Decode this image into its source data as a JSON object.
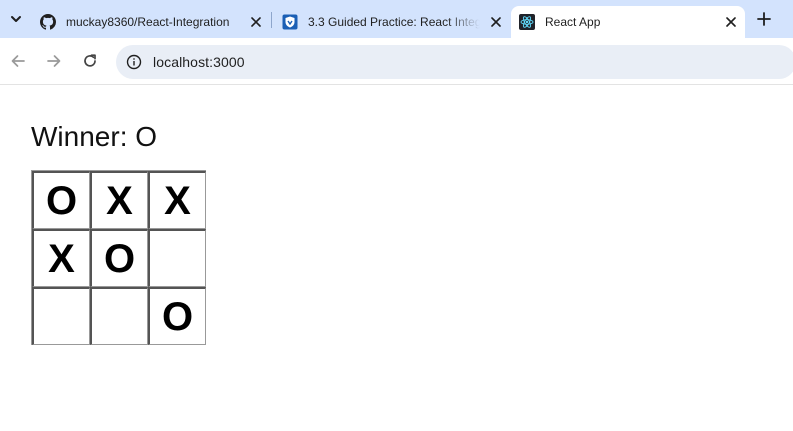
{
  "browser": {
    "tabs": [
      {
        "title": "muckay8360/React-Integration",
        "favicon": "github-icon",
        "active": false
      },
      {
        "title": "3.3 Guided Practice: React Integ",
        "favicon": "shield-icon",
        "active": false
      },
      {
        "title": "React App",
        "favicon": "react-icon",
        "active": true
      }
    ],
    "url": "localhost:3000"
  },
  "game": {
    "status": "Winner: O",
    "board": [
      [
        "O",
        "X",
        "X"
      ],
      [
        "X",
        "O",
        ""
      ],
      [
        "",
        "",
        "O"
      ]
    ]
  }
}
